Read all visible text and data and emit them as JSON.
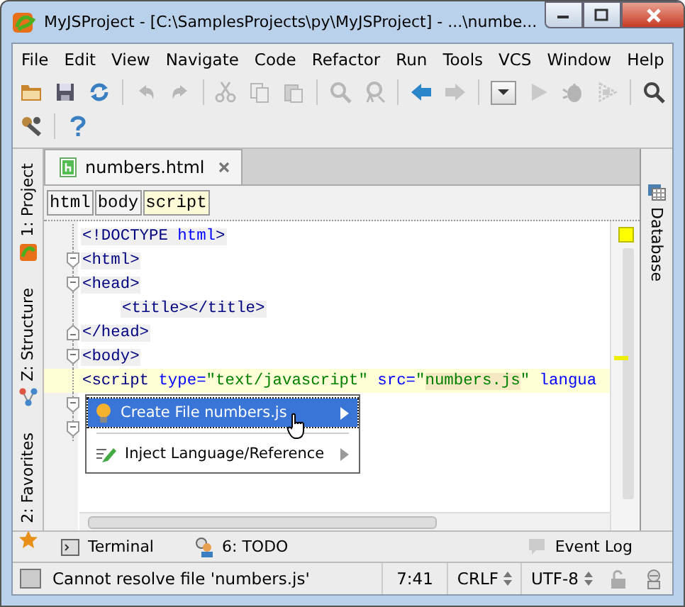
{
  "window": {
    "title": "MyJSProject - [C:\\SamplesProjects\\py\\MyJSProject] - ...\\numbe..."
  },
  "menu": [
    "File",
    "Edit",
    "View",
    "Navigate",
    "Code",
    "Refactor",
    "Run",
    "Tools",
    "VCS",
    "Window",
    "Help"
  ],
  "toolbar_rows": [
    [
      {
        "kind": "folder",
        "disabled": false
      },
      {
        "kind": "save",
        "disabled": false
      },
      {
        "kind": "sync",
        "disabled": false
      },
      {
        "kind": "sep"
      },
      {
        "kind": "undo",
        "disabled": true
      },
      {
        "kind": "redo",
        "disabled": true
      },
      {
        "kind": "sep"
      },
      {
        "kind": "cut",
        "disabled": true
      },
      {
        "kind": "copy",
        "disabled": true
      },
      {
        "kind": "paste",
        "disabled": true
      },
      {
        "kind": "sep"
      },
      {
        "kind": "find",
        "disabled": true
      },
      {
        "kind": "replace",
        "disabled": true
      },
      {
        "kind": "sep"
      },
      {
        "kind": "back",
        "disabled": false
      },
      {
        "kind": "forward",
        "disabled": true
      },
      {
        "kind": "sep"
      },
      {
        "kind": "dropdown",
        "disabled": false
      },
      {
        "kind": "run",
        "disabled": true
      },
      {
        "kind": "debug",
        "disabled": true
      },
      {
        "kind": "coverage",
        "disabled": true
      },
      {
        "kind": "sep"
      },
      {
        "kind": "search",
        "disabled": false
      }
    ],
    [
      {
        "kind": "settings",
        "disabled": false
      },
      {
        "kind": "sep"
      },
      {
        "kind": "help",
        "disabled": false
      }
    ]
  ],
  "left_tool_tabs": [
    {
      "label": "1: Project",
      "kind": "project"
    },
    {
      "label": "Z: Structure",
      "kind": "structure"
    },
    {
      "label": "2: Favorites",
      "kind": "favorites"
    }
  ],
  "right_tool_tabs": [
    {
      "label": "Database",
      "kind": "database"
    }
  ],
  "editor_tabs": [
    {
      "label": "numbers.html",
      "selected": true
    }
  ],
  "breadcrumbs": [
    {
      "label": "html",
      "selected": false
    },
    {
      "label": "body",
      "selected": false
    },
    {
      "label": "script",
      "selected": true
    }
  ],
  "code_lines": [
    {
      "kind": "plain",
      "current": false,
      "indent": false,
      "tokens": [
        {
          "kind": "tag",
          "text": "<!DOCTYPE "
        },
        {
          "kind": "attr",
          "text": "html"
        },
        {
          "kind": "tag",
          "text": ">"
        }
      ]
    },
    {
      "kind": "fold-start",
      "current": false,
      "indent": false,
      "tokens": [
        {
          "kind": "tag",
          "text": "<html>"
        }
      ]
    },
    {
      "kind": "fold-start",
      "current": false,
      "indent": false,
      "tokens": [
        {
          "kind": "tag",
          "text": "<head>"
        }
      ]
    },
    {
      "kind": "plain",
      "current": false,
      "indent": true,
      "tokens": [
        {
          "kind": "tag",
          "text": "<title></title>"
        }
      ]
    },
    {
      "kind": "fold-end",
      "current": false,
      "indent": false,
      "tokens": [
        {
          "kind": "tag",
          "text": "</head>"
        }
      ]
    },
    {
      "kind": "fold-start",
      "current": false,
      "indent": false,
      "tokens": [
        {
          "kind": "tag",
          "text": "<body>"
        }
      ]
    },
    {
      "kind": "plain",
      "current": true,
      "indent": false,
      "tokens": [
        {
          "kind": "tag",
          "text": "<script "
        },
        {
          "kind": "attr",
          "text": "type="
        },
        {
          "kind": "value",
          "text": "\"text/javascript\""
        },
        {
          "kind": "attr",
          "text": " src="
        },
        {
          "kind": "value",
          "text": "\""
        },
        {
          "kind": "ref",
          "text": "numbers.js"
        },
        {
          "kind": "value",
          "text": "\""
        },
        {
          "kind": "attr",
          "text": " langua"
        }
      ]
    },
    {
      "kind": "fold-start",
      "current": false
    },
    {
      "kind": "fold-start",
      "current": false
    }
  ],
  "intention_popup": [
    {
      "label": "Create File numbers.js",
      "kind": "bulb",
      "selected": true
    },
    {
      "label": "Inject Language/Reference",
      "kind": "pen",
      "selected": false
    }
  ],
  "bottom_tool_tabs": [
    {
      "label": "Terminal",
      "kind": "terminal"
    },
    {
      "label": "6: TODO",
      "kind": "todo"
    },
    {
      "label": "Event Log",
      "kind": "log"
    }
  ],
  "status_bar": {
    "message": "Cannot resolve file 'numbers.js'",
    "position": "7:41",
    "line_separator": "CRLF",
    "encoding": "UTF-8"
  }
}
